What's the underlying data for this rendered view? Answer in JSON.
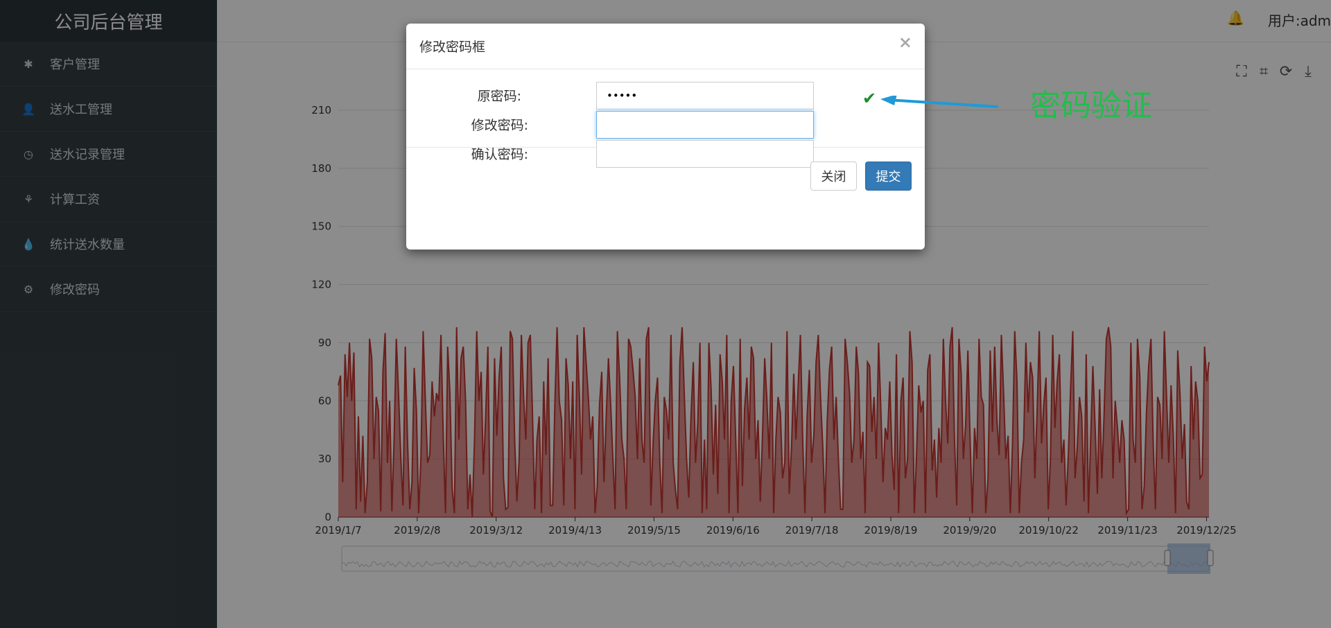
{
  "sidebar": {
    "brand": "公司后台管理",
    "items": [
      {
        "label": "客户管理",
        "icon": "asterisk-icon"
      },
      {
        "label": "送水工管理",
        "icon": "user-icon"
      },
      {
        "label": "送水记录管理",
        "icon": "clock-icon"
      },
      {
        "label": "计算工资",
        "icon": "grain-icon"
      },
      {
        "label": "统计送水数量",
        "icon": "water-drop-icon"
      },
      {
        "label": "修改密码",
        "icon": "gear-icon"
      }
    ]
  },
  "header": {
    "user_text": "用户:adm"
  },
  "chart_data": {
    "type": "area",
    "x_ticks": [
      "2019/1/7",
      "2019/2/8",
      "2019/3/12",
      "2019/4/13",
      "2019/5/15",
      "2019/6/16",
      "2019/7/18",
      "2019/8/19",
      "2019/9/20",
      "2019/10/22",
      "2019/11/23",
      "2019/12/25"
    ],
    "y_ticks": [
      "0",
      "30",
      "60",
      "90",
      "120",
      "150",
      "180",
      "210"
    ],
    "ylim": [
      0,
      210
    ],
    "x_range": [
      "2019/1/7",
      "2019/12/26"
    ],
    "series": [
      {
        "color": "#c23531",
        "values": [
          68,
          73,
          18,
          84,
          62,
          90,
          60,
          85,
          4,
          52,
          8,
          42,
          2,
          18,
          92,
          82,
          30,
          62,
          55,
          3,
          75,
          95,
          28,
          60,
          3,
          40,
          92,
          63,
          30,
          6,
          88,
          40,
          4,
          18,
          77,
          55,
          2,
          30,
          96,
          60,
          28,
          32,
          70,
          52,
          64,
          60,
          94,
          42,
          2,
          88,
          64,
          15,
          2,
          98,
          40,
          82,
          88,
          60,
          4,
          22,
          0,
          40,
          96,
          60,
          75,
          22,
          52,
          88,
          3,
          0,
          82,
          42,
          72,
          88,
          20,
          4,
          5,
          96,
          92,
          40,
          8,
          30,
          94,
          62,
          40,
          90,
          94,
          52,
          4,
          40,
          52,
          2,
          70,
          32,
          82,
          6,
          6,
          58,
          98,
          60,
          50,
          6,
          82,
          68,
          30,
          70,
          4,
          94,
          62,
          22,
          98,
          80,
          62,
          40,
          52,
          2,
          16,
          58,
          75,
          18,
          52,
          82,
          58,
          30,
          4,
          96,
          72,
          40,
          30,
          4,
          92,
          88,
          76,
          62,
          30,
          82,
          40,
          28,
          92,
          98,
          6,
          38,
          60,
          72,
          28,
          2,
          62,
          55,
          40,
          94,
          28,
          14,
          4,
          80,
          98,
          62,
          30,
          10,
          52,
          80,
          28,
          48,
          90,
          2,
          40,
          4,
          90,
          66,
          22,
          58,
          12,
          84,
          70,
          40,
          94,
          2,
          60,
          78,
          40,
          2,
          92,
          16,
          56,
          72,
          40,
          88,
          82,
          30,
          50,
          8,
          42,
          82,
          60,
          30,
          90,
          2,
          40,
          62,
          54,
          20,
          28,
          96,
          12,
          36,
          74,
          40,
          68,
          94,
          40,
          2,
          52,
          76,
          28,
          42,
          80,
          94,
          62,
          36,
          2,
          50,
          76,
          88,
          40,
          62,
          30,
          4,
          4,
          92,
          80,
          64,
          28,
          40,
          88,
          74,
          30,
          44,
          2,
          80,
          78,
          44,
          62,
          30,
          90,
          56,
          18,
          46,
          40,
          70,
          32,
          14,
          84,
          2,
          60,
          72,
          20,
          30,
          96,
          80,
          2,
          32,
          68,
          54,
          60,
          2,
          76,
          84,
          24,
          40,
          10,
          46,
          28,
          92,
          60,
          38,
          88,
          98,
          40,
          6,
          92,
          74,
          30,
          48,
          86,
          40,
          2,
          46,
          30,
          92,
          62,
          58,
          2,
          20,
          86,
          44,
          88,
          50,
          32,
          94,
          64,
          30,
          42,
          2,
          38,
          96,
          70,
          2,
          28,
          40,
          90,
          54,
          80,
          72,
          20,
          54,
          96,
          38,
          58,
          72,
          4,
          30,
          94,
          46,
          70,
          84,
          28,
          40,
          6,
          32,
          66,
          96,
          20,
          36,
          62,
          52,
          8,
          84,
          2,
          40,
          78,
          46,
          12,
          66,
          20,
          52,
          92,
          98,
          88,
          20,
          60,
          46,
          28,
          50,
          40,
          2,
          4,
          90,
          40,
          28,
          92,
          72,
          4,
          16,
          54,
          78,
          92,
          38,
          4,
          62,
          58,
          30,
          96,
          62,
          28,
          68,
          42,
          2,
          86,
          64,
          30,
          48,
          8,
          4,
          78,
          40,
          70,
          60,
          20,
          22,
          88,
          70,
          80
        ]
      }
    ]
  },
  "toolbox": {
    "icons": [
      "zoom-select-icon",
      "zoom-reset-icon",
      "restore-icon",
      "download-icon"
    ]
  },
  "modal": {
    "title": "修改密码框",
    "close_glyph": "×",
    "fields": [
      {
        "label": "原密码:",
        "value": "•••••",
        "placeholder": ""
      },
      {
        "label": "修改密码:",
        "value": "",
        "placeholder": ""
      },
      {
        "label": "确认密码:",
        "value": "",
        "placeholder": ""
      }
    ],
    "close_button": "关闭",
    "submit_button": "提交"
  },
  "annotation": {
    "text": "密码验证",
    "color": "#1fbf4a",
    "arrow_color": "#1f9ad6"
  }
}
